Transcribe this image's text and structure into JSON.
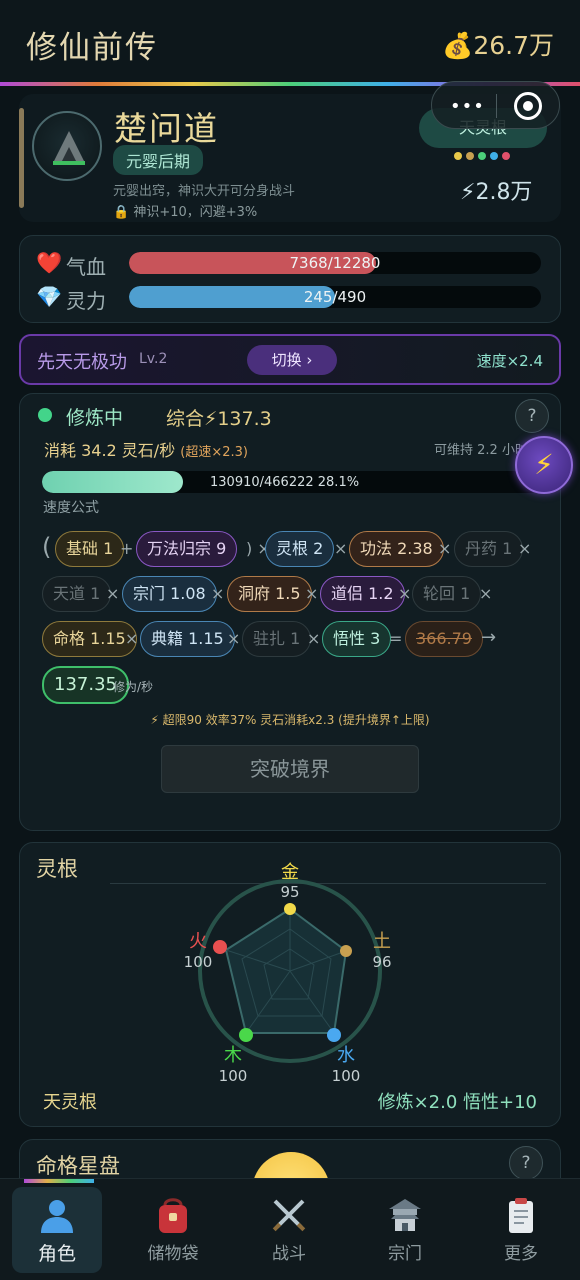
{
  "header": {
    "title": "修仙前传",
    "coins": "💰26.7万"
  },
  "profile": {
    "name": "楚问道",
    "realm": "元婴后期",
    "realm_desc": "元婴出窍，神识大开可分身战斗",
    "realm_bonus": "🔒 神识+10，闪避+3%",
    "root_badge": "天灵根",
    "root_dots": [
      "#e8c94a",
      "#c8a050",
      "#4ccf7a",
      "#3fb0e8",
      "#e0506a"
    ],
    "power": "⚡2.8万"
  },
  "capsule": {
    "menu": "•••"
  },
  "vitals": {
    "hp": {
      "label": "气血",
      "icon": "❤️",
      "text": "7368/12280",
      "fraction": 0.6,
      "color": "#c8545a"
    },
    "mp": {
      "label": "灵力",
      "icon": "💎",
      "text": "245/490",
      "fraction": 0.5,
      "color": "#4f9fd0"
    }
  },
  "technique": {
    "name": "先天无极功",
    "level": "Lv.2",
    "switch": "切换 ›",
    "speed": "速度×2.4"
  },
  "cultivation": {
    "status": "修炼中",
    "total": "综合⚡137.3",
    "consume": "消耗 34.2 灵石/秒",
    "consume_over": "(超速×2.3)",
    "sustain": "可维持 2.2 小时",
    "help": "?",
    "xp_text": "130910/466222  28.1%",
    "xp_fraction": 0.281,
    "formula_label": "速度公式",
    "open_paren": "(",
    "chips": {
      "basic": "基础 1",
      "wanfa": "万法归宗 9",
      "linggen": "灵根 2",
      "gongfa": "功法 2.38",
      "danyao": "丹药 1",
      "tiandao": "天道 1",
      "zongmen": "宗门 1.08",
      "dongfu": "洞府 1.5",
      "daolv": "道侣 1.2",
      "lunhui": "轮回 1",
      "minge": "命格 1.15",
      "dianji": "典籍 1.15",
      "zhuzha": "驻扎 1",
      "wuxing": "悟性 3",
      "raw": "366.79",
      "final": "137.35"
    },
    "ops": {
      "plus": "+",
      "times": "×",
      "close": ") ×",
      "equals": "=",
      "arrow": "→",
      "unit": "修为/秒"
    },
    "note": "⚡ 超限90 效率37% 灵石消耗x2.3 (提升境界↑上限)",
    "breakthrough": "突破境界",
    "lightning": "⚡"
  },
  "spirit_root": {
    "title": "灵根",
    "elements": {
      "jin": {
        "label": "金",
        "value": "95"
      },
      "tu": {
        "label": "土",
        "value": "96"
      },
      "shui": {
        "label": "水",
        "value": "100"
      },
      "mu": {
        "label": "木",
        "value": "100"
      },
      "huo": {
        "label": "火",
        "value": "100"
      }
    },
    "name": "天灵根",
    "bonus": "修炼×2.0  悟性+10"
  },
  "destiny": {
    "title": "命格星盘",
    "help": "?"
  },
  "nav": [
    {
      "label": "角色",
      "icon": "character-icon"
    },
    {
      "label": "储物袋",
      "icon": "bag-icon"
    },
    {
      "label": "战斗",
      "icon": "swords-icon"
    },
    {
      "label": "宗门",
      "icon": "temple-icon"
    },
    {
      "label": "更多",
      "icon": "clipboard-icon"
    }
  ]
}
